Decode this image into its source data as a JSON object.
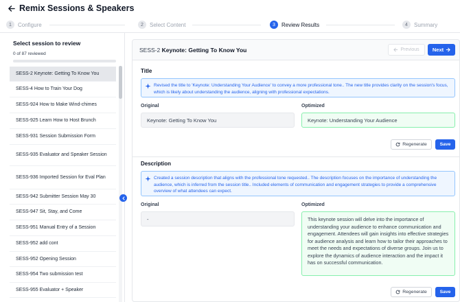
{
  "app": {
    "title": "Remix Sessions & Speakers"
  },
  "steps": [
    {
      "num": "1",
      "label": "Configure"
    },
    {
      "num": "2",
      "label": "Select Content"
    },
    {
      "num": "3",
      "label": "Review Results"
    },
    {
      "num": "4",
      "label": "Summary"
    }
  ],
  "sidebar": {
    "title": "Select session to review",
    "count": "0 of 87 reviewed",
    "progress": 0,
    "sessions": [
      "SESS-2 Keynote: Getting To Know You",
      "SESS-4 How to Train Your Dog",
      "SESS-924 How to Make Wind-chimes",
      "SESS-925 Learn How to Host Brunch",
      "SESS-931 Session Submission Form",
      "SESS-935 Evaluator and Speaker Session",
      "SESS-936 Imported Session for Eval Plan",
      "SESS-942 Submitter Session May 30",
      "SESS-947 Sit, Stay, and Come",
      "SESS-951 Manual Entry of a Session",
      "SESS-952 add cont",
      "SESS-952 Opening Session",
      "SESS-954 Two submission test",
      "SESS-955 Evaluator + Speaker"
    ]
  },
  "main": {
    "session_code": "SESS-2",
    "session_title": "Keynote: Getting To Know You",
    "prev_label": "Previous",
    "next_label": "Next",
    "title_section": {
      "heading": "Title",
      "info": "Revised the title to 'Keynote: Understanding Your Audience' to convey a more professional tone.. The new title provides clarity on the session's focus, which is likely about understanding the audience, aligning with professional expectations.",
      "original_label": "Original",
      "optimized_label": "Optimized",
      "original": "Keynote: Getting To Know You",
      "optimized": "Keynote: Understanding Your Audience",
      "regenerate_label": "Regenerate",
      "save_label": "Save"
    },
    "description_section": {
      "heading": "Description",
      "info": "Created a session description that aligns with the professional tone requested.. The description focuses on the importance of understanding the audience, which is inferred from the session title.. Included elements of communication and engagement strategies to provide a comprehensive overview of what attendees can expect.",
      "original_label": "Original",
      "optimized_label": "Optimized",
      "original": "-",
      "optimized": "This keynote session will delve into the importance of understanding your audience to enhance communication and engagement. Attendees will gain insights into effective strategies for audience analysis and learn how to tailor their approaches to meet the needs and expectations of diverse groups. Join us to explore the dynamics of audience interaction and the impact it has on successful communication.",
      "regenerate_label": "Regenerate",
      "save_label": "Save"
    }
  },
  "colors": {
    "accent": "#2563eb",
    "info_bg": "#eff6ff",
    "optimized_bg": "#f0fdf4",
    "optimized_border": "#86efac"
  }
}
